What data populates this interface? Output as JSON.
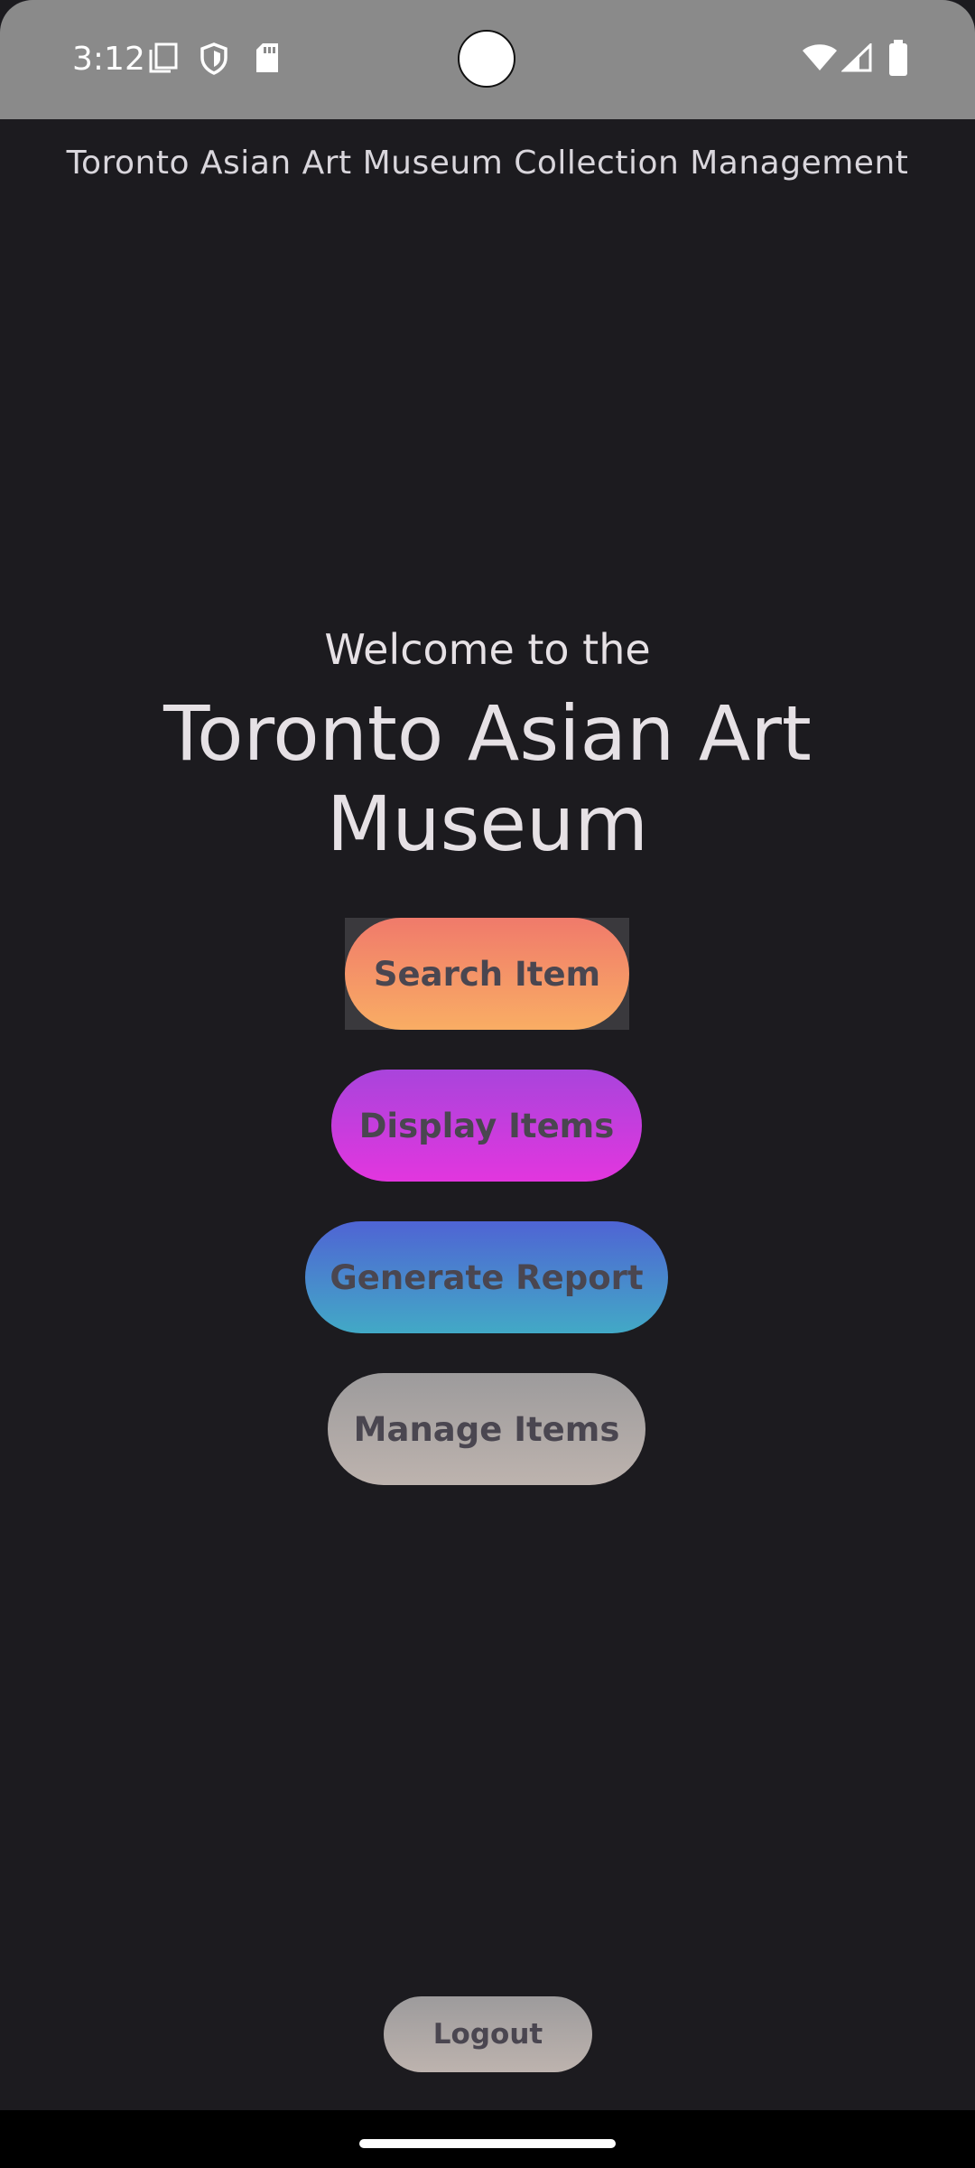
{
  "status_bar": {
    "time": "3:12",
    "icons_left": [
      "screenshot-icon",
      "shield-icon",
      "sd-card-icon"
    ],
    "icons_right": [
      "wifi-icon",
      "cell-signal-icon",
      "battery-icon"
    ]
  },
  "header": {
    "title": "Toronto Asian Art Museum Collection Management"
  },
  "welcome": {
    "intro": "Welcome to the",
    "museum_name": "Toronto Asian Art Museum"
  },
  "actions": {
    "search_label": "Search Item",
    "display_label": "Display Items",
    "report_label": "Generate Report",
    "manage_label": "Manage Items"
  },
  "footer": {
    "logout_label": "Logout"
  },
  "colors": {
    "background": "#1c1b1f",
    "status_bar": "#8a8a8a",
    "search_gradient": [
      "#f07a6b",
      "#f9ad64"
    ],
    "display_gradient": [
      "#a944dc",
      "#e236de"
    ],
    "report_gradient": [
      "#4f64d4",
      "#42a9c6"
    ],
    "manage_gradient": [
      "#9d9b9c",
      "#bdb3ae"
    ],
    "button_text": "#4a4650",
    "title_text": "#e6e1e5"
  }
}
